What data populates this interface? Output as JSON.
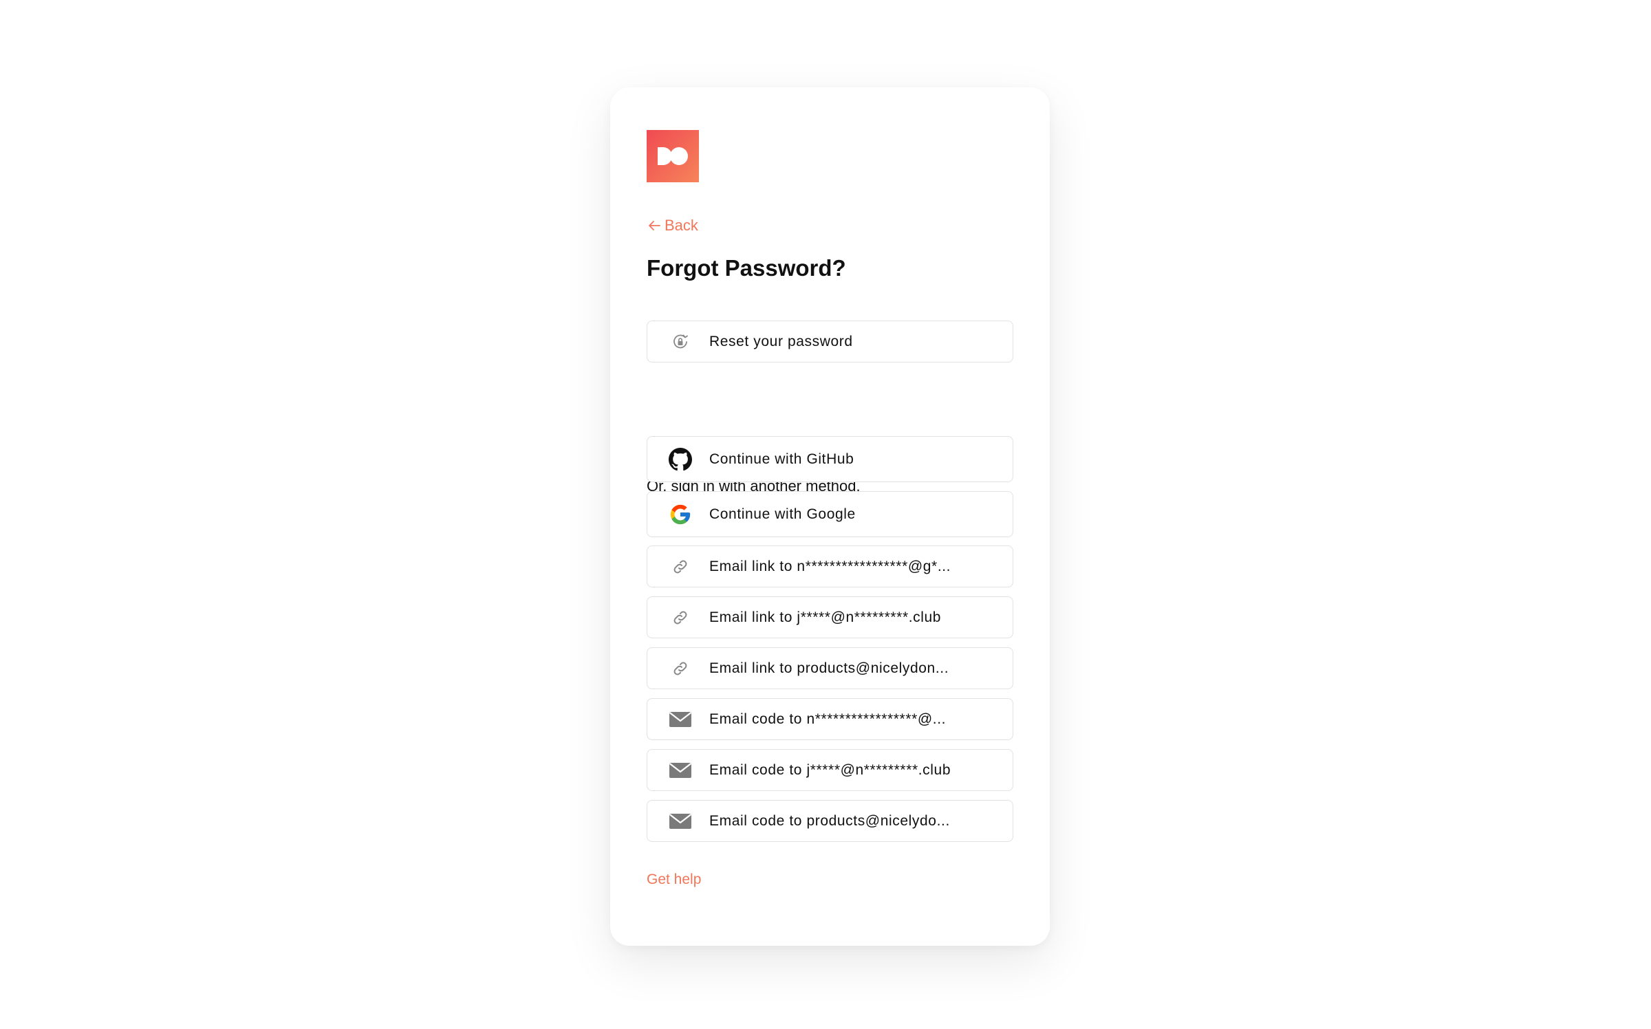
{
  "brand": {
    "logo_icon": "brand-logo-icon",
    "accent_color": "#f1765a"
  },
  "nav": {
    "back_label": "Back",
    "back_icon": "arrow-left-icon"
  },
  "page": {
    "title": "Forgot Password?"
  },
  "reset": {
    "label": "Reset your password",
    "icon": "lock-reset-icon"
  },
  "alt_methods": {
    "intro": "Or, sign in with another method.",
    "items": [
      {
        "label": "Continue with GitHub",
        "icon": "github-icon"
      },
      {
        "label": "Continue with Google",
        "icon": "google-icon"
      },
      {
        "label": "Email link to n*****************@g*...",
        "icon": "link-icon"
      },
      {
        "label": "Email link to j*****@n*********.club",
        "icon": "link-icon"
      },
      {
        "label": "Email link to products@nicelydon...",
        "icon": "link-icon"
      },
      {
        "label": "Email code to n*****************@...",
        "icon": "mail-icon"
      },
      {
        "label": "Email code to j*****@n*********.club",
        "icon": "mail-icon"
      },
      {
        "label": "Email code to products@nicelydo...",
        "icon": "mail-icon"
      }
    ]
  },
  "footer": {
    "help_label": "Get help"
  }
}
